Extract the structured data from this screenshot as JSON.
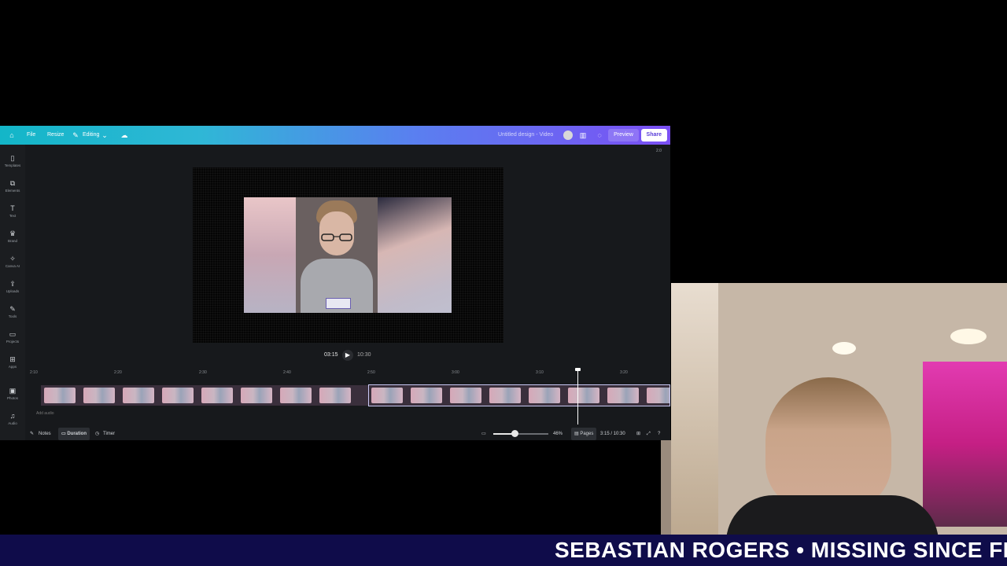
{
  "topbar": {
    "file": "File",
    "resize": "Resize",
    "editing": "Editing",
    "doc_title": "Untitled design - Video",
    "preview": "Preview",
    "share": "Share"
  },
  "corner_badge": "2.0",
  "sidebar": {
    "items": [
      {
        "label": "Templates",
        "icon": "templates-icon",
        "glyph": "▯"
      },
      {
        "label": "Elements",
        "icon": "elements-icon",
        "glyph": "⧉"
      },
      {
        "label": "Text",
        "icon": "text-icon",
        "glyph": "T"
      },
      {
        "label": "Brand",
        "icon": "brand-icon",
        "glyph": "♛"
      },
      {
        "label": "Canva AI",
        "icon": "canva-ai-icon",
        "glyph": "✧"
      },
      {
        "label": "Uploads",
        "icon": "uploads-icon",
        "glyph": "⇪"
      },
      {
        "label": "Tools",
        "icon": "tools-icon",
        "glyph": "✎"
      },
      {
        "label": "Projects",
        "icon": "projects-icon",
        "glyph": "▭"
      },
      {
        "label": "Apps",
        "icon": "apps-icon",
        "glyph": "⊞"
      },
      {
        "label": "Photos",
        "icon": "photos-icon",
        "glyph": "▣"
      },
      {
        "label": "Audio",
        "icon": "audio-icon",
        "glyph": "♫"
      }
    ]
  },
  "playback": {
    "current": "03:15",
    "total": "10:30"
  },
  "timeline": {
    "ticks": [
      "2:10",
      "2:20",
      "2:30",
      "2:40",
      "2:50",
      "3:00",
      "3:10",
      "3:20"
    ],
    "add_audio": "Add audio"
  },
  "footer": {
    "notes": "Notes",
    "duration": "Duration",
    "timer": "Timer",
    "zoom": "46%",
    "zoom_level": 0.46,
    "pages": "Pages",
    "position": "3:15 / 10:30"
  },
  "ticker": {
    "text": "SEBASTIAN ROGERS • MISSING SINCE FEBR"
  },
  "colors": {
    "topbar_start": "#13b6c8",
    "topbar_end": "#7b4ff4",
    "ticker_bg": "#0f0c4a",
    "share_text": "#5b3fd9"
  }
}
